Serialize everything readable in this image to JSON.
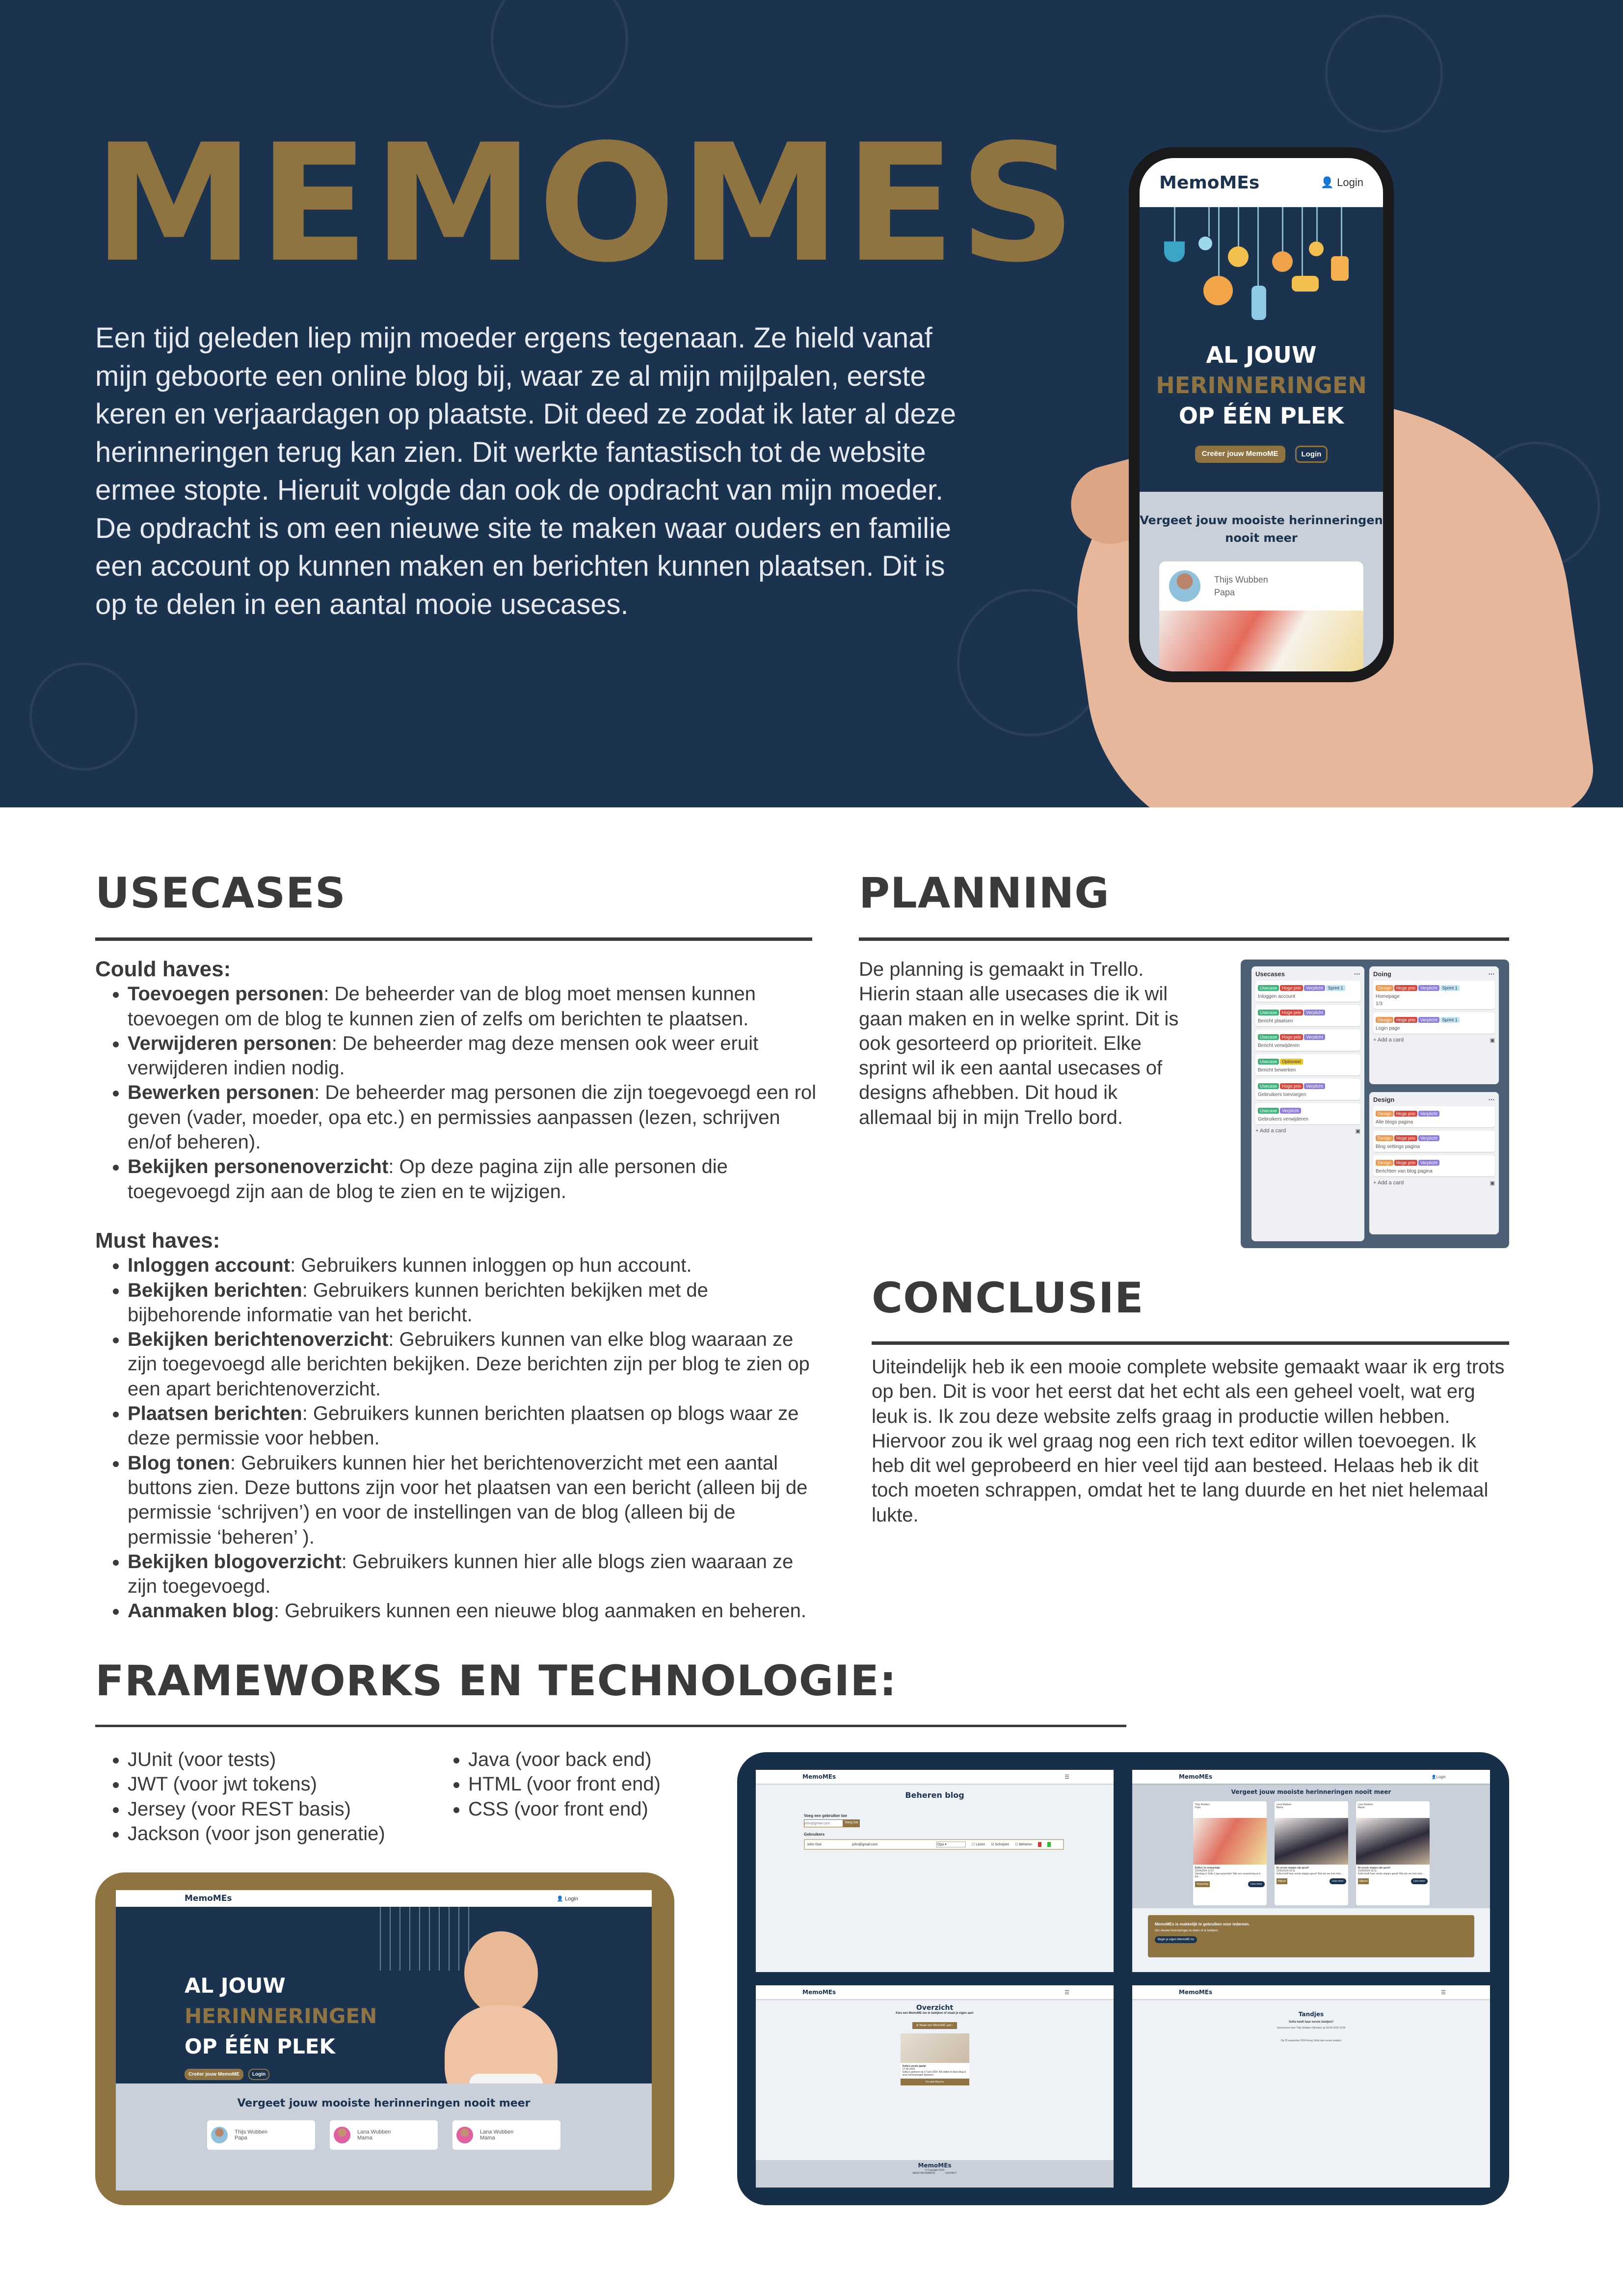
{
  "hero": {
    "title": "MEMOMES",
    "paragraph_1": "Een tijd geleden liep mijn moeder ergens tegenaan. Ze hield vanaf mijn geboorte een online blog bij, waar ze al mijn mijlpalen, eerste keren en verjaardagen op plaatste. Dit deed ze zodat ik later al deze herinneringen terug kan zien. Dit werkte fantastisch tot de website ermee stopte. Hieruit volgde dan ook de opdracht van mijn moeder.",
    "paragraph_2": "De opdracht is om een nieuwe site te maken waar ouders en familie een account op kunnen maken en berichten kunnen plaatsen. Dit is op te delen in een aantal mooie usecases."
  },
  "phone": {
    "logo": "MemoMEs",
    "login": "Login",
    "headline_1": "AL JOUW",
    "headline_2": "HERINNERINGEN",
    "headline_3": "OP ÉÉN PLEK",
    "create_button": "Creëer jouw MemoME",
    "login_button": "Login",
    "tagline": "Vergeet jouw mooiste herinneringen nooit meer",
    "card_name": "Thijs Wubben",
    "card_role": "Papa"
  },
  "usecases": {
    "heading": "USECASES",
    "could_label": "Could haves:",
    "could": [
      {
        "title": "Toevoegen personen",
        "text": ": De beheerder van de blog moet mensen kunnen toevoegen om de blog te kunnen zien of zelfs om berichten te plaatsen."
      },
      {
        "title": "Verwijderen personen",
        "text": ": De beheerder mag deze mensen ook weer eruit verwijderen indien nodig."
      },
      {
        "title": "Bewerken personen",
        "text": ": De beheerder mag personen die zijn toegevoegd een rol geven (vader, moeder, opa etc.) en permissies aanpassen (lezen, schrijven en/of beheren)."
      },
      {
        "title": "Bekijken personenoverzicht",
        "text": ": Op deze pagina zijn alle personen die toegevoegd zijn aan de blog te zien en te wijzigen."
      }
    ],
    "must_label": "Must haves:",
    "must": [
      {
        "title": "Inloggen account",
        "text": ": Gebruikers kunnen inloggen op hun account."
      },
      {
        "title": "Bekijken berichten",
        "text": ": Gebruikers kunnen berichten bekijken met de bijbehorende informatie van het bericht."
      },
      {
        "title": "Bekijken berichtenoverzicht",
        "text": ": Gebruikers kunnen van elke blog waaraan ze zijn toegevoegd alle berichten bekijken. Deze berichten zijn per blog te zien op een apart berichtenoverzicht."
      },
      {
        "title": "Plaatsen berichten",
        "text": ": Gebruikers kunnen berichten plaatsen op blogs waar ze deze permissie voor hebben."
      },
      {
        "title": "Blog tonen",
        "text": ": Gebruikers kunnen hier het berichtenoverzicht met een aantal buttons zien. Deze buttons zijn voor het plaatsen van een bericht (alleen bij de permissie ‘schrijven’) en voor de instellingen van de blog (alleen bij de permissie ‘beheren’ )."
      },
      {
        "title": "Bekijken blogoverzicht",
        "text": ": Gebruikers kunnen hier alle blogs zien waaraan ze zijn toegevoegd."
      },
      {
        "title": "Aanmaken blog",
        "text": ": Gebruikers kunnen een nieuwe blog aanmaken en beheren."
      }
    ]
  },
  "planning": {
    "heading": "PLANNING",
    "text": "De planning is gemaakt in Trello. Hierin staan alle usecases die ik wil gaan maken en in welke sprint. Dit is ook gesorteerd op prioriteit.  Elke sprint wil ik een aantal usecases of designs afhebben. Dit houd ik allemaal bij in mijn Trello bord.",
    "trello": {
      "add_card": "+ Add a card",
      "menu": "···",
      "columns": [
        {
          "title": "Usecases",
          "cards": [
            {
              "tags": [
                "Usecase",
                "Hoge prio",
                "Verplicht",
                "Sprint 1"
              ],
              "name": "Inloggen account"
            },
            {
              "tags": [
                "Usecase",
                "Hoge prio",
                "Verplicht"
              ],
              "name": "Bericht plaatsen"
            },
            {
              "tags": [
                "Usecase",
                "Hoge prio",
                "Verplicht"
              ],
              "name": "Bericht verwijderen"
            },
            {
              "tags": [
                "Usecase",
                "Optioneel"
              ],
              "name": "Bericht bewerken"
            },
            {
              "tags": [
                "Usecase",
                "Hoge prio",
                "Verplicht"
              ],
              "name": "Gebruikers toevoegen"
            },
            {
              "tags": [
                "Usecase",
                "Verplicht"
              ],
              "name": "Gebruikers verwijderen"
            }
          ]
        },
        {
          "title": "Doing",
          "cards": [
            {
              "tags": [
                "Design",
                "Hoge prio",
                "Verplicht",
                "Sprint 1"
              ],
              "name": "Homepage",
              "checklist": "1/3"
            },
            {
              "tags": [
                "Design",
                "Hoge prio",
                "Verplicht",
                "Sprint 1"
              ],
              "name": "Login page"
            }
          ]
        },
        {
          "title": "Design",
          "cards": [
            {
              "tags": [
                "Design",
                "Hoge prio",
                "Verplicht"
              ],
              "name": "Alle blogs pagina"
            },
            {
              "tags": [
                "Design",
                "Hoge prio",
                "Verplicht"
              ],
              "name": "Blog settings pagina"
            },
            {
              "tags": [
                "Design",
                "Hoge prio",
                "Verplicht"
              ],
              "name": "Berichten van blog pagina"
            }
          ]
        }
      ],
      "tag_colors": {
        "Usecase": "#3fb07a",
        "Hoge prio": "#d9453b",
        "Verplicht": "#8f7ce0",
        "Sprint 1": "#bfe6f2",
        "Optioneel": "#e8c531",
        "Design": "#f0964e"
      }
    }
  },
  "conclusie": {
    "heading": "CONCLUSIE",
    "text": "Uiteindelijk heb ik een mooie complete website gemaakt waar ik erg trots op ben. Dit is voor het eerst dat het echt als een geheel voelt, wat erg leuk is. Ik zou deze website zelfs graag in productie willen hebben. Hiervoor zou ik wel graag nog een rich text editor willen toevoegen. Ik heb dit wel geprobeerd en hier veel tijd aan besteed. Helaas heb ik dit toch moeten schrappen, omdat het te lang duurde en het niet helemaal lukte."
  },
  "frameworks": {
    "heading": "FRAMEWORKS EN TECHNOLOGIE:",
    "col1": [
      "JUnit (voor tests)",
      "JWT (voor jwt tokens)",
      "Jersey (voor REST basis)",
      "Jackson (voor json generatie)"
    ],
    "col2": [
      "Java (voor back end)",
      "HTML (voor front end)",
      "CSS (voor front end)"
    ]
  },
  "laptop": {
    "logo": "MemoMEs",
    "login": "Login",
    "headline_1": "AL JOUW",
    "headline_2": "HERINNERINGEN",
    "headline_3": "OP ÉÉN PLEK",
    "create_button": "Creëer jouw MemoME",
    "login_button": "Login",
    "tagline": "Vergeet jouw mooiste herinneringen nooit meer",
    "cards": [
      {
        "name": "Thijs Wubben",
        "role": "Papa"
      },
      {
        "name": "Lana Wubben",
        "role": "Mama"
      },
      {
        "name": "Lana Wubben",
        "role": "Mama"
      }
    ]
  },
  "screens": {
    "logo": "MemoMEs",
    "login": "Login",
    "beheren": {
      "title": "Beheren blog",
      "add_label": "Voeg een gebruiker toe",
      "add_placeholder": "john@gmail.com",
      "add_button": "Voeg toe",
      "users_label": "Gebruikers",
      "user_name": "John Doe",
      "user_email": "john@gmail.com",
      "user_role": "Opa",
      "perm_read": "Lezen",
      "perm_write": "Schrijven",
      "perm_manage": "Beheren"
    },
    "home": {
      "title": "Vergeet jouw mooiste herinneringen nooit meer",
      "posts": [
        {
          "name": "Thijs Wubben",
          "role": "Papa",
          "title": "Sofia's 1e verjaardag!",
          "date": "22/04/2024 13:37",
          "text": "Vandaag is Sofia 1 jaar geworden! Wat een verandering al in het ...",
          "tag": "Verjaardag",
          "button": "Lees meer"
        },
        {
          "name": "Lana Wubben",
          "role": "Mama",
          "title": "De eerste stapjes zijn gezet!",
          "date": "15/06/2024 15:11",
          "text": "Sofia heeft haar eerste stapjes gezet! Wat zijn we toch trots ...",
          "tag": "Mijlpaal",
          "button": "Lees meer"
        },
        {
          "name": "Lana Wubben",
          "role": "Mama",
          "title": "De eerste stapjes zijn gezet!",
          "date": "15/06/2024 15:11",
          "text": "Sofia heeft haar eerste stapjes gezet! Wat zijn we toch trots ...",
          "tag": "Mijlpaal",
          "button": "Lees meer"
        }
      ],
      "banner_title": "MemoMEs is makkelijk te gebruiken voor iedereen.",
      "banner_text": "Om nieuwe herinneringen te delen of te bekijken.",
      "banner_button": "Begin je eigen MemoME nu"
    },
    "overzicht": {
      "title": "Overzicht",
      "subtitle": "Kies een MemoME om te bekijken of maak je eigen aan!",
      "create_button": "Maak een MemoME aan",
      "card_title": "Sofia's eerste jaartje",
      "card_date": "17-06-2024",
      "card_text": "Sofia is geboren op 17 juni 2024. We willen in deze blog al onze herinneringen bewaren.",
      "card_button": "Ga naar blog toe",
      "footer_logo": "MemoMEs",
      "footer_copyright": "© Copyright 2024",
      "footer_link_1": "MEER INFORMATIE",
      "footer_link_2": "CONTACT"
    },
    "tandjes": {
      "title": "Tandjes",
      "subtitle": "Sofia heeft haar eerste tandjes!!",
      "meta": "Geschreven door Thijs Wubben (Moeder) op 30-06-2024 15:05",
      "body": "Op 25 september 2024 kreeg Sofia haar eerste tandjes!"
    }
  },
  "colors": {
    "navy": "#1c3350",
    "gold": "#8f7340",
    "text": "#3a3a38"
  }
}
